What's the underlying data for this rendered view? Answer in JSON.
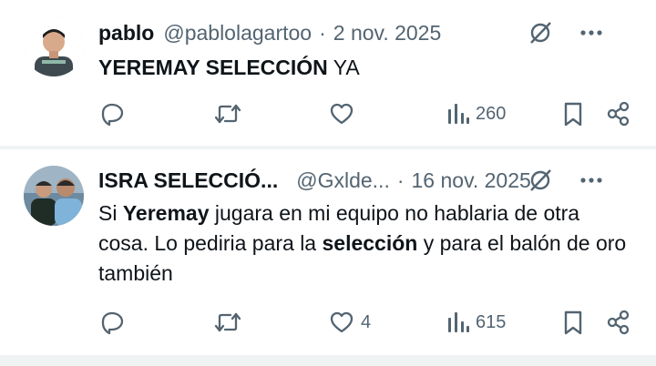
{
  "tweets": [
    {
      "name": "pablo",
      "handle": "@pablolagartoo",
      "separator": "·",
      "date": "2 nov. 2025",
      "body": [
        {
          "text": "YEREMAY SELECCIÓN",
          "bold": true
        },
        {
          "text": " YA",
          "bold": false
        }
      ],
      "replies": "",
      "retweets": "",
      "likes": "",
      "views": "260"
    },
    {
      "name": "ISRA SELECCIÓ...",
      "handle": "@Gxlde...",
      "separator": "·",
      "date": "16 nov. 2025",
      "body": [
        {
          "text": "Si ",
          "bold": false
        },
        {
          "text": "Yeremay",
          "bold": true
        },
        {
          "text": " jugara en mi equipo no hablaria de otra cosa. Lo pediria para la ",
          "bold": false
        },
        {
          "text": "selección",
          "bold": true
        },
        {
          "text": " y para el balón de oro también",
          "bold": false
        }
      ],
      "replies": "",
      "retweets": "",
      "likes": "4",
      "views": "615"
    }
  ],
  "colors": {
    "text": "#0f1419",
    "secondary": "#536471",
    "divider": "#eff3f4"
  },
  "icons": [
    "grok-icon",
    "more-icon",
    "reply-icon",
    "retweet-icon",
    "like-icon",
    "views-icon",
    "bookmark-icon",
    "share-icon"
  ]
}
